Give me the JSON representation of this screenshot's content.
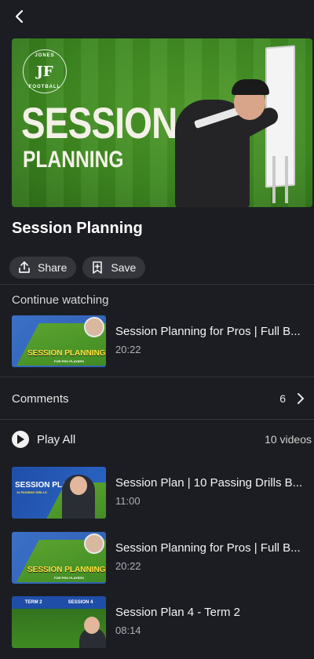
{
  "hero": {
    "logo_letters": "JF",
    "logo_top": "JONES",
    "logo_bottom": "FOOTBALL",
    "headline_main": "SESSION",
    "headline_sub": "PLANNING"
  },
  "title": "Session Planning",
  "actions": {
    "share": "Share",
    "save": "Save"
  },
  "continue": {
    "label": "Continue watching",
    "item": {
      "title": "Session Planning for Pros | Full B...",
      "duration": "20:22",
      "thumb_text": "SESSION PLANNING",
      "thumb_sub": "FOR PRO PLAYERS"
    }
  },
  "comments": {
    "label": "Comments",
    "count": "6"
  },
  "playlist": {
    "play_all": "Play All",
    "video_count": "10 videos",
    "items": [
      {
        "title": "Session Plan | 10 Passing Drills B...",
        "duration": "11:00",
        "thumb_text": "SESSION PLAN",
        "thumb_sub": "10 PASSING DRILLS"
      },
      {
        "title": "Session Planning for Pros | Full B...",
        "duration": "20:22",
        "thumb_text": "SESSION PLANNING",
        "thumb_sub": "FOR PRO PLAYERS"
      },
      {
        "title": "Session Plan 4 - Term 2",
        "duration": "08:14",
        "thumb_left": "TERM 2",
        "thumb_right": "SESSION 4"
      }
    ]
  },
  "colors": {
    "background": "#1c1d22",
    "pill": "#34363c",
    "accent_yellow": "#ffe33b",
    "pitch_green": "#3f8a22"
  },
  "icons": [
    "back-arrow-icon",
    "share-icon",
    "save-icon",
    "chevron-right-icon",
    "play-icon"
  ]
}
